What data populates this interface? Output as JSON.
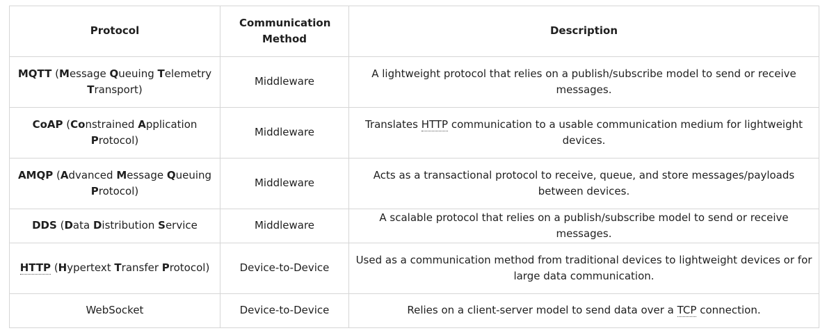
{
  "headers": {
    "protocol": "Protocol",
    "method": "Communication Method",
    "description": "Description"
  },
  "rows": [
    {
      "abbr": "MQTT",
      "expansion": [
        {
          "text": " (",
          "bold": false
        },
        {
          "text": "M",
          "bold": true
        },
        {
          "text": "essage ",
          "bold": false
        },
        {
          "text": "Q",
          "bold": true
        },
        {
          "text": "ueuing ",
          "bold": false
        },
        {
          "text": "T",
          "bold": true
        },
        {
          "text": "elemetry ",
          "bold": false
        },
        {
          "text": "T",
          "bold": true
        },
        {
          "text": "ransport)",
          "bold": false
        }
      ],
      "method": "Middleware",
      "description": [
        {
          "text": "A lightweight protocol that relies on a publish/subscribe model to send or receive messages."
        }
      ]
    },
    {
      "abbr": "CoAP",
      "expansion": [
        {
          "text": " (",
          "bold": false
        },
        {
          "text": "Co",
          "bold": true
        },
        {
          "text": "nstrained ",
          "bold": false
        },
        {
          "text": "A",
          "bold": true
        },
        {
          "text": "pplication ",
          "bold": false
        },
        {
          "text": "P",
          "bold": true
        },
        {
          "text": "rotocol)",
          "bold": false
        }
      ],
      "method": "Middleware",
      "description": [
        {
          "text": "Translates "
        },
        {
          "text": "HTTP",
          "abbr": true
        },
        {
          "text": " communication to a usable communication medium for lightweight devices."
        }
      ]
    },
    {
      "abbr": "AMQP",
      "expansion": [
        {
          "text": " (",
          "bold": false
        },
        {
          "text": "A",
          "bold": true
        },
        {
          "text": "dvanced ",
          "bold": false
        },
        {
          "text": "M",
          "bold": true
        },
        {
          "text": "essage ",
          "bold": false
        },
        {
          "text": "Q",
          "bold": true
        },
        {
          "text": "ueuing ",
          "bold": false
        },
        {
          "text": "P",
          "bold": true
        },
        {
          "text": "rotocol)",
          "bold": false
        }
      ],
      "method": "Middleware",
      "description": [
        {
          "text": "Acts as a transactional protocol to receive, queue, and store messages/payloads between devices."
        }
      ]
    },
    {
      "abbr": "DDS",
      "expansion": [
        {
          "text": " (",
          "bold": false
        },
        {
          "text": "D",
          "bold": true
        },
        {
          "text": "ata ",
          "bold": false
        },
        {
          "text": "D",
          "bold": true
        },
        {
          "text": "istribution ",
          "bold": false
        },
        {
          "text": "S",
          "bold": true
        },
        {
          "text": "ervice",
          "bold": false
        }
      ],
      "method": "Middleware",
      "description": [
        {
          "text": "A scalable protocol that relies on a publish/subscribe model to send or receive messages."
        }
      ]
    },
    {
      "abbr": "HTTP",
      "abbr_dotted": true,
      "expansion": [
        {
          "text": " (",
          "bold": false
        },
        {
          "text": "H",
          "bold": true
        },
        {
          "text": "ypert",
          "bold": false
        },
        {
          "text": "e",
          "bold": false
        },
        {
          "text": "xt ",
          "bold": false
        },
        {
          "text": "T",
          "bold": true
        },
        {
          "text": "ransfer ",
          "bold": false
        },
        {
          "text": "P",
          "bold": true
        },
        {
          "text": "rotocol)",
          "bold": false
        }
      ],
      "method": "Device-to-Device",
      "description": [
        {
          "text": "Used as a communication method from traditional devices to lightweight devices or for large data communication."
        }
      ]
    },
    {
      "abbr": "",
      "expansion": [
        {
          "text": "WebSocket",
          "bold": false
        }
      ],
      "method": "Device-to-Device",
      "description": [
        {
          "text": "Relies on a client-server model to send data over a "
        },
        {
          "text": "TCP",
          "abbr": true
        },
        {
          "text": " connection."
        }
      ]
    }
  ]
}
